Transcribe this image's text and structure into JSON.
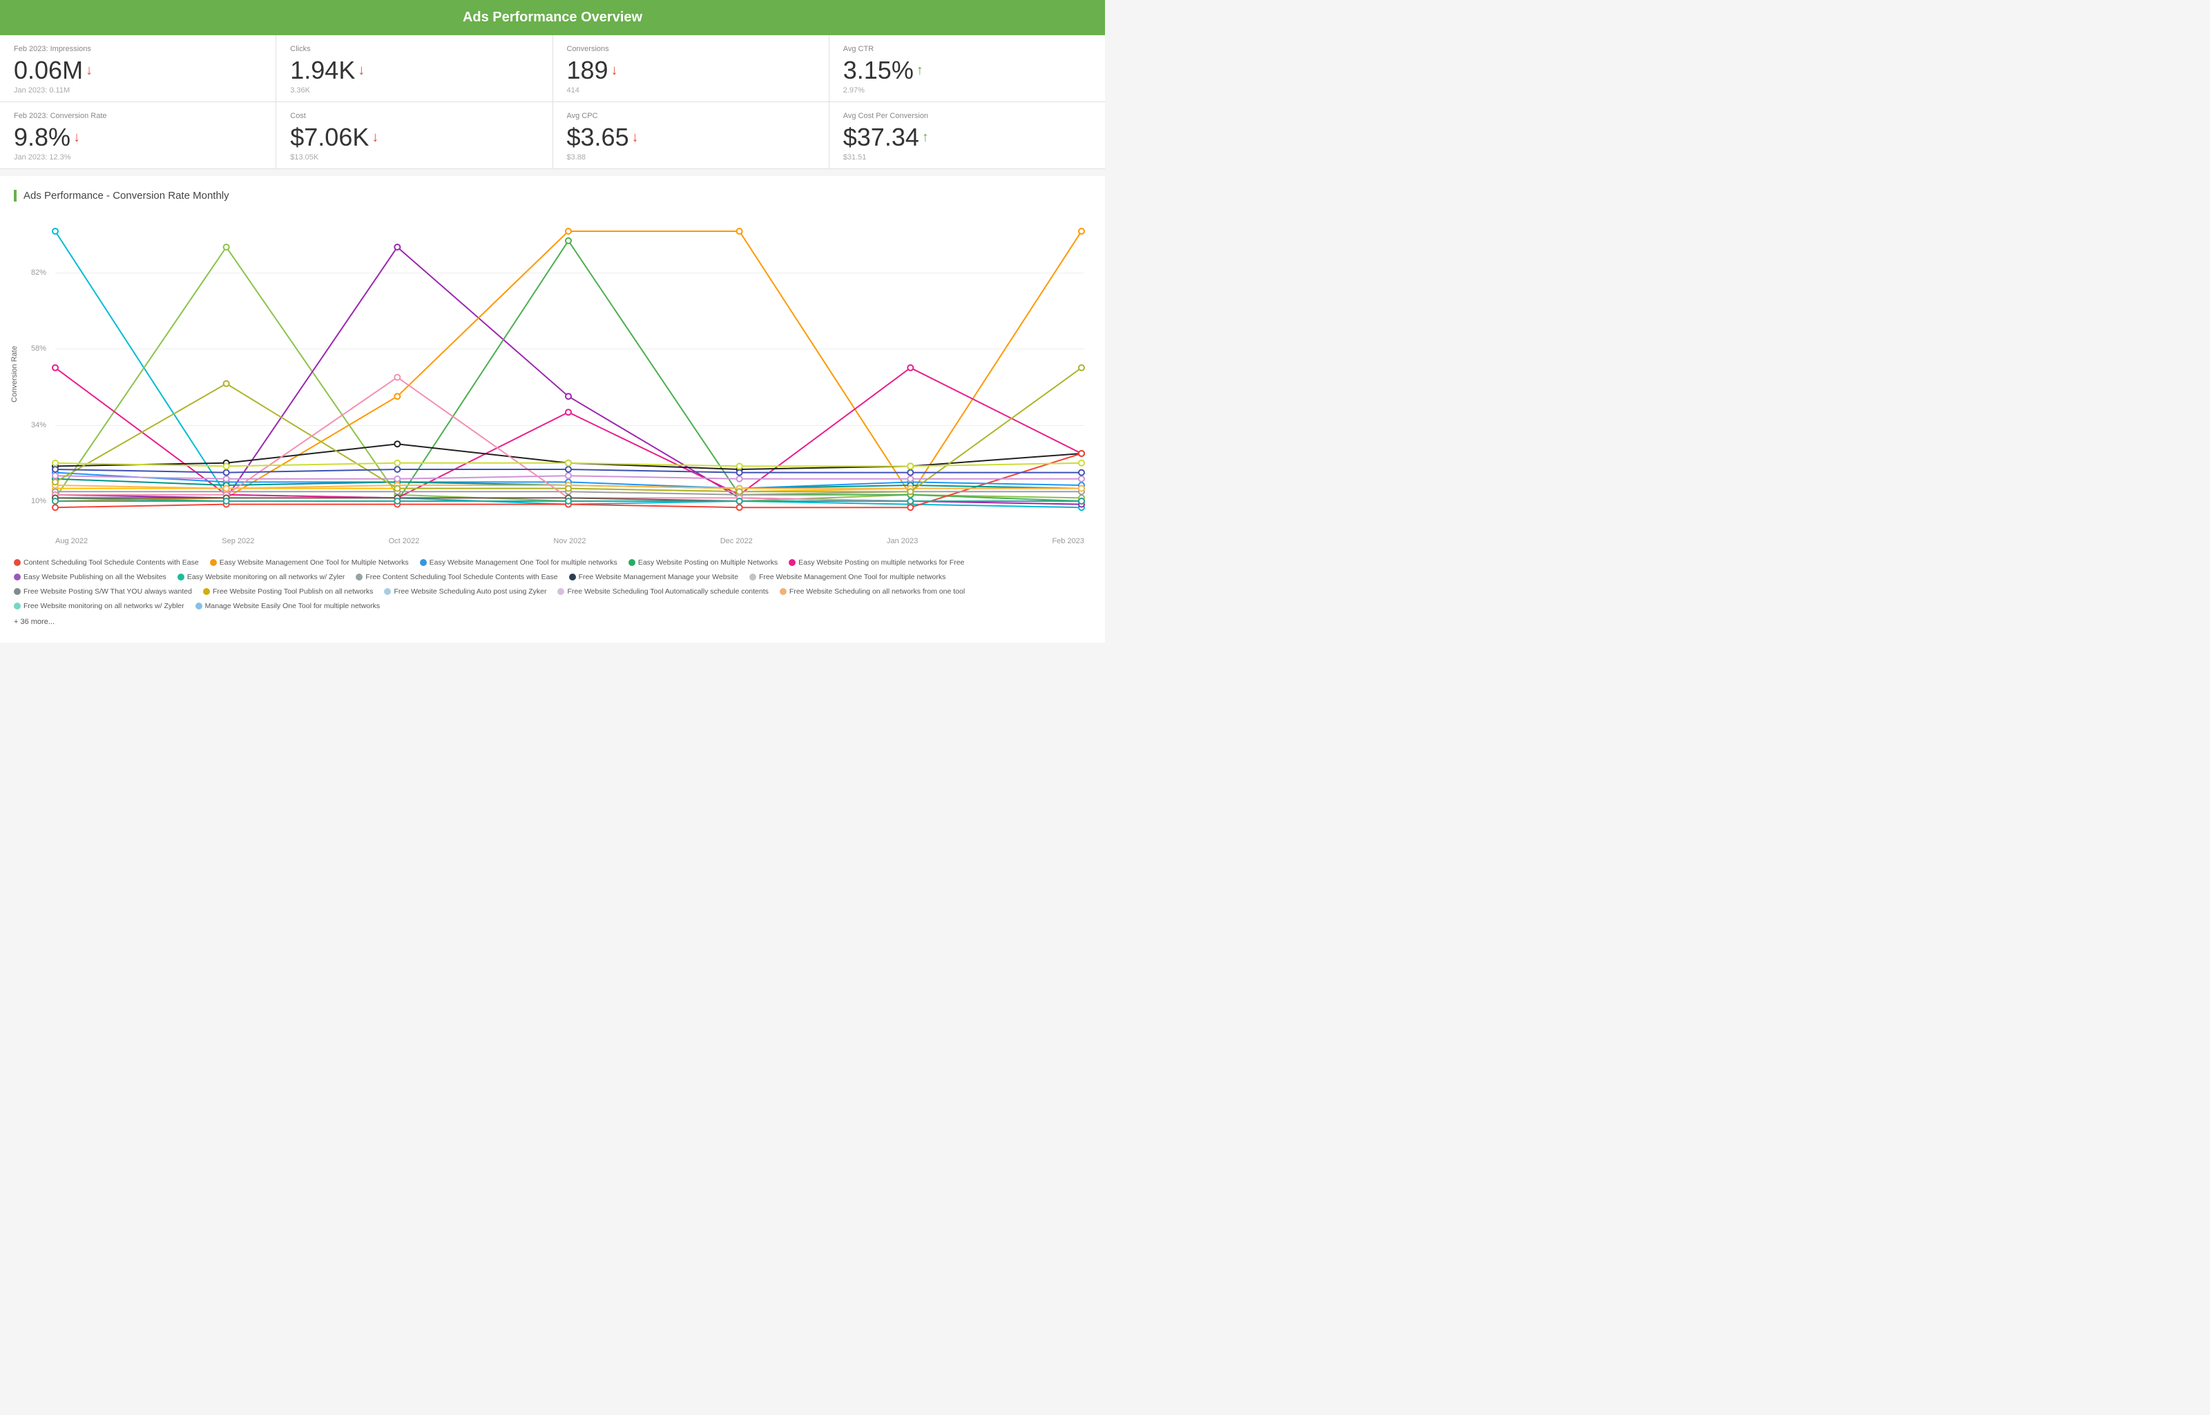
{
  "header": {
    "title": "Ads Performance Overview"
  },
  "metrics_top": [
    {
      "label": "Feb 2023: Impressions",
      "value": "0.06M",
      "arrow": "down",
      "prev": "Jan 2023: 0.11M"
    },
    {
      "label": "Clicks",
      "value": "1.94K",
      "arrow": "down",
      "prev": "3.36K"
    },
    {
      "label": "Conversions",
      "value": "189",
      "arrow": "down",
      "prev": "414"
    },
    {
      "label": "Avg CTR",
      "value": "3.15%",
      "arrow": "up",
      "prev": "2.97%"
    }
  ],
  "metrics_bottom": [
    {
      "label": "Feb 2023: Conversion Rate",
      "value": "9.8%",
      "arrow": "down",
      "prev": "Jan 2023: 12.3%"
    },
    {
      "label": "Cost",
      "value": "$7.06K",
      "arrow": "down",
      "prev": "$13.05K"
    },
    {
      "label": "Avg CPC",
      "value": "$3.65",
      "arrow": "down",
      "prev": "$3.88"
    },
    {
      "label": "Avg Cost Per Conversion",
      "value": "$37.34",
      "arrow": "up",
      "prev": "$31.51"
    }
  ],
  "chart": {
    "title": "Ads Performance - Conversion Rate Monthly",
    "y_axis_label": "Conversion Rate",
    "y_ticks": [
      "10%",
      "34%",
      "58%",
      "82%"
    ],
    "x_ticks": [
      "Aug 2022",
      "Sep 2022",
      "Oct 2022",
      "Nov 2022",
      "Dec 2022",
      "Jan 2023",
      "Feb 2023"
    ]
  },
  "legend": {
    "items": [
      {
        "label": "Content Scheduling Tool Schedule Contents with Ease",
        "color": "#e74c3c"
      },
      {
        "label": "Easy Website Management One Tool for Multiple Networks",
        "color": "#f39c12"
      },
      {
        "label": "Easy Website Management One Tool for multiple networks",
        "color": "#3498db"
      },
      {
        "label": "Easy Website Posting on Multiple Networks",
        "color": "#27ae60"
      },
      {
        "label": "Easy Website Posting on multiple networks for Free",
        "color": "#e91e8c"
      },
      {
        "label": "Easy Website Publishing on all the Websites",
        "color": "#9b59b6"
      },
      {
        "label": "Easy Website monitoring on all networks w/ Zyler",
        "color": "#1abc9c"
      },
      {
        "label": "Free Content Scheduling Tool Schedule Contents with Ease",
        "color": "#95a5a6"
      },
      {
        "label": "Free Website Management Manage your Website",
        "color": "#2c3e50"
      },
      {
        "label": "Free Website Management One Tool for multiple networks",
        "color": "#bdc3c7"
      },
      {
        "label": "Free Website Posting S/W That YOU always wanted",
        "color": "#7f8c8d"
      },
      {
        "label": "Free Website Posting Tool Publish on all networks",
        "color": "#d4ac0d"
      },
      {
        "label": "Free Website Scheduling Auto post using Zyker",
        "color": "#a9cce3"
      },
      {
        "label": "Free Website Scheduling Tool Automatically schedule contents",
        "color": "#d7bde2"
      },
      {
        "label": "Free Website Scheduling on all networks from one tool",
        "color": "#f0b27a"
      },
      {
        "label": "Free Website monitoring on all networks w/ Zybler",
        "color": "#76d7c4"
      },
      {
        "label": "Manage Website Easily One Tool for multiple networks",
        "color": "#85c1e9"
      }
    ],
    "more": "+ 36 more..."
  }
}
